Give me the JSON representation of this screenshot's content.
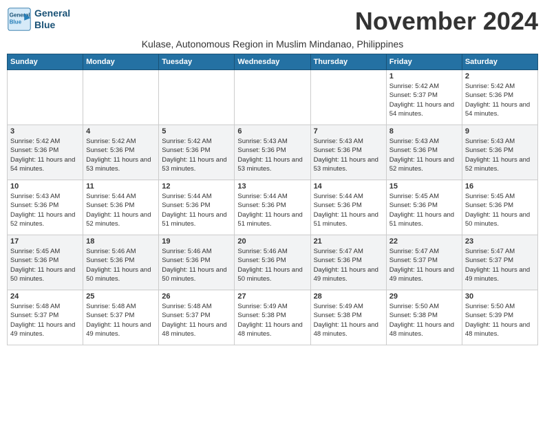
{
  "header": {
    "logo_line1": "General",
    "logo_line2": "Blue",
    "month_title": "November 2024",
    "subtitle": "Kulase, Autonomous Region in Muslim Mindanao, Philippines"
  },
  "weekdays": [
    "Sunday",
    "Monday",
    "Tuesday",
    "Wednesday",
    "Thursday",
    "Friday",
    "Saturday"
  ],
  "weeks": [
    [
      {
        "day": "",
        "info": ""
      },
      {
        "day": "",
        "info": ""
      },
      {
        "day": "",
        "info": ""
      },
      {
        "day": "",
        "info": ""
      },
      {
        "day": "",
        "info": ""
      },
      {
        "day": "1",
        "info": "Sunrise: 5:42 AM\nSunset: 5:37 PM\nDaylight: 11 hours and 54 minutes."
      },
      {
        "day": "2",
        "info": "Sunrise: 5:42 AM\nSunset: 5:36 PM\nDaylight: 11 hours and 54 minutes."
      }
    ],
    [
      {
        "day": "3",
        "info": "Sunrise: 5:42 AM\nSunset: 5:36 PM\nDaylight: 11 hours and 54 minutes."
      },
      {
        "day": "4",
        "info": "Sunrise: 5:42 AM\nSunset: 5:36 PM\nDaylight: 11 hours and 53 minutes."
      },
      {
        "day": "5",
        "info": "Sunrise: 5:42 AM\nSunset: 5:36 PM\nDaylight: 11 hours and 53 minutes."
      },
      {
        "day": "6",
        "info": "Sunrise: 5:43 AM\nSunset: 5:36 PM\nDaylight: 11 hours and 53 minutes."
      },
      {
        "day": "7",
        "info": "Sunrise: 5:43 AM\nSunset: 5:36 PM\nDaylight: 11 hours and 53 minutes."
      },
      {
        "day": "8",
        "info": "Sunrise: 5:43 AM\nSunset: 5:36 PM\nDaylight: 11 hours and 52 minutes."
      },
      {
        "day": "9",
        "info": "Sunrise: 5:43 AM\nSunset: 5:36 PM\nDaylight: 11 hours and 52 minutes."
      }
    ],
    [
      {
        "day": "10",
        "info": "Sunrise: 5:43 AM\nSunset: 5:36 PM\nDaylight: 11 hours and 52 minutes."
      },
      {
        "day": "11",
        "info": "Sunrise: 5:44 AM\nSunset: 5:36 PM\nDaylight: 11 hours and 52 minutes."
      },
      {
        "day": "12",
        "info": "Sunrise: 5:44 AM\nSunset: 5:36 PM\nDaylight: 11 hours and 51 minutes."
      },
      {
        "day": "13",
        "info": "Sunrise: 5:44 AM\nSunset: 5:36 PM\nDaylight: 11 hours and 51 minutes."
      },
      {
        "day": "14",
        "info": "Sunrise: 5:44 AM\nSunset: 5:36 PM\nDaylight: 11 hours and 51 minutes."
      },
      {
        "day": "15",
        "info": "Sunrise: 5:45 AM\nSunset: 5:36 PM\nDaylight: 11 hours and 51 minutes."
      },
      {
        "day": "16",
        "info": "Sunrise: 5:45 AM\nSunset: 5:36 PM\nDaylight: 11 hours and 50 minutes."
      }
    ],
    [
      {
        "day": "17",
        "info": "Sunrise: 5:45 AM\nSunset: 5:36 PM\nDaylight: 11 hours and 50 minutes."
      },
      {
        "day": "18",
        "info": "Sunrise: 5:46 AM\nSunset: 5:36 PM\nDaylight: 11 hours and 50 minutes."
      },
      {
        "day": "19",
        "info": "Sunrise: 5:46 AM\nSunset: 5:36 PM\nDaylight: 11 hours and 50 minutes."
      },
      {
        "day": "20",
        "info": "Sunrise: 5:46 AM\nSunset: 5:36 PM\nDaylight: 11 hours and 50 minutes."
      },
      {
        "day": "21",
        "info": "Sunrise: 5:47 AM\nSunset: 5:36 PM\nDaylight: 11 hours and 49 minutes."
      },
      {
        "day": "22",
        "info": "Sunrise: 5:47 AM\nSunset: 5:37 PM\nDaylight: 11 hours and 49 minutes."
      },
      {
        "day": "23",
        "info": "Sunrise: 5:47 AM\nSunset: 5:37 PM\nDaylight: 11 hours and 49 minutes."
      }
    ],
    [
      {
        "day": "24",
        "info": "Sunrise: 5:48 AM\nSunset: 5:37 PM\nDaylight: 11 hours and 49 minutes."
      },
      {
        "day": "25",
        "info": "Sunrise: 5:48 AM\nSunset: 5:37 PM\nDaylight: 11 hours and 49 minutes."
      },
      {
        "day": "26",
        "info": "Sunrise: 5:48 AM\nSunset: 5:37 PM\nDaylight: 11 hours and 48 minutes."
      },
      {
        "day": "27",
        "info": "Sunrise: 5:49 AM\nSunset: 5:38 PM\nDaylight: 11 hours and 48 minutes."
      },
      {
        "day": "28",
        "info": "Sunrise: 5:49 AM\nSunset: 5:38 PM\nDaylight: 11 hours and 48 minutes."
      },
      {
        "day": "29",
        "info": "Sunrise: 5:50 AM\nSunset: 5:38 PM\nDaylight: 11 hours and 48 minutes."
      },
      {
        "day": "30",
        "info": "Sunrise: 5:50 AM\nSunset: 5:39 PM\nDaylight: 11 hours and 48 minutes."
      }
    ]
  ]
}
